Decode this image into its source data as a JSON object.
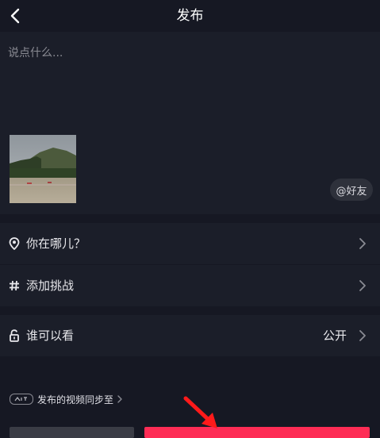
{
  "header": {
    "title": "发布"
  },
  "compose": {
    "placeholder": "说点什么...",
    "at_friend_label": "@好友"
  },
  "rows": [
    {
      "label": "你在哪儿？",
      "icon": "location-pin-icon"
    },
    {
      "label": "添加挑战",
      "icon": "hashtag-icon"
    },
    {
      "label": "谁可以看",
      "icon": "unlock-icon",
      "value": "公开"
    }
  ],
  "sync": {
    "label": "发布的视频同步至",
    "logo": "jinritoutiao-logo-icon"
  },
  "colors": {
    "background": "#161823",
    "panel": "#1b1e29",
    "accent": "#fe2c55",
    "annotation_arrow": "#ff1a1a"
  }
}
